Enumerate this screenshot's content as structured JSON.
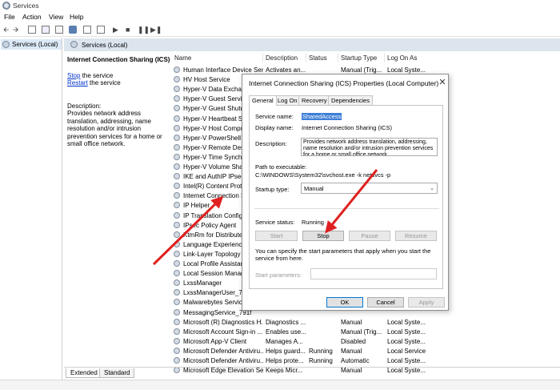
{
  "window": {
    "title": "Services"
  },
  "menu": [
    "File",
    "Action",
    "View",
    "Help"
  ],
  "left_pane": {
    "item": "Services (Local)"
  },
  "header": {
    "title": "Services (Local)"
  },
  "description_pane": {
    "service_name": "Internet Connection Sharing (ICS)",
    "stop_link": "Stop",
    "stop_suffix": " the service",
    "restart_link": "Restart",
    "restart_suffix": " the service",
    "description_label": "Description:",
    "description_text": "Provides network address translation, addressing, name resolution and/or intrusion prevention services for a home or small office network."
  },
  "columns": {
    "name": "Name",
    "description": "Description",
    "status": "Status",
    "startup_type": "Startup Type",
    "log_on_as": "Log On As"
  },
  "rows": [
    {
      "name": "Human Interface Device Ser...",
      "description": "Activates an...",
      "status": "",
      "startup": "Manual (Trig...",
      "logon": "Local Syste..."
    },
    {
      "name": "HV Host Service",
      "description": "",
      "status": "",
      "startup": "",
      "logon": ""
    },
    {
      "name": "Hyper-V Data Exchange",
      "description": "",
      "status": "",
      "startup": "",
      "logon": ""
    },
    {
      "name": "Hyper-V Guest Service",
      "description": "",
      "status": "",
      "startup": "",
      "logon": ""
    },
    {
      "name": "Hyper-V Guest Shutdo",
      "description": "",
      "status": "",
      "startup": "",
      "logon": ""
    },
    {
      "name": "Hyper-V Heartbeat Serv",
      "description": "",
      "status": "",
      "startup": "",
      "logon": ""
    },
    {
      "name": "Hyper-V Host Compute",
      "description": "",
      "status": "",
      "startup": "",
      "logon": ""
    },
    {
      "name": "Hyper-V PowerShell Di",
      "description": "",
      "status": "",
      "startup": "",
      "logon": ""
    },
    {
      "name": "Hyper-V Remote Deskt",
      "description": "",
      "status": "",
      "startup": "",
      "logon": ""
    },
    {
      "name": "Hyper-V Time Synchro",
      "description": "",
      "status": "",
      "startup": "",
      "logon": ""
    },
    {
      "name": "Hyper-V Volume Shade",
      "description": "",
      "status": "",
      "startup": "",
      "logon": ""
    },
    {
      "name": "IKE and AuthIP IPsec K",
      "description": "",
      "status": "",
      "startup": "",
      "logon": ""
    },
    {
      "name": "Intel(R) Content Protec",
      "description": "",
      "status": "",
      "startup": "",
      "logon": ""
    },
    {
      "name": "Internet Connection Sh",
      "description": "",
      "status": "",
      "startup": "",
      "logon": ""
    },
    {
      "name": "IP Helper",
      "description": "",
      "status": "",
      "startup": "",
      "logon": ""
    },
    {
      "name": "IP Translation Configu",
      "description": "",
      "status": "",
      "startup": "",
      "logon": ""
    },
    {
      "name": "IPsec Policy Agent",
      "description": "",
      "status": "",
      "startup": "",
      "logon": ""
    },
    {
      "name": "KtmRm for Distributed",
      "description": "",
      "status": "",
      "startup": "",
      "logon": ""
    },
    {
      "name": "Language Experience S",
      "description": "",
      "status": "",
      "startup": "",
      "logon": ""
    },
    {
      "name": "Link-Layer Topology Di",
      "description": "",
      "status": "",
      "startup": "",
      "logon": ""
    },
    {
      "name": "Local Profile Assistant S",
      "description": "",
      "status": "",
      "startup": "",
      "logon": ""
    },
    {
      "name": "Local Session Manager",
      "description": "",
      "status": "",
      "startup": "",
      "logon": ""
    },
    {
      "name": "LxssManager",
      "description": "",
      "status": "",
      "startup": "",
      "logon": ""
    },
    {
      "name": "LxssManagerUser_791f",
      "description": "",
      "status": "",
      "startup": "",
      "logon": ""
    },
    {
      "name": "Malwarebytes Service",
      "description": "",
      "status": "",
      "startup": "",
      "logon": ""
    },
    {
      "name": "MessagingService_791f",
      "description": "",
      "status": "",
      "startup": "",
      "logon": ""
    },
    {
      "name": "Microsoft (R) Diagnostics H...",
      "description": "Diagnostics ...",
      "status": "",
      "startup": "Manual",
      "logon": "Local Syste..."
    },
    {
      "name": "Microsoft Account Sign-in ...",
      "description": "Enables use...",
      "status": "",
      "startup": "Manual (Trig...",
      "logon": "Local Syste..."
    },
    {
      "name": "Microsoft App-V Client",
      "description": "Manages A...",
      "status": "",
      "startup": "Disabled",
      "logon": "Local Syste..."
    },
    {
      "name": "Microsoft Defender Antiviru...",
      "description": "Helps guard...",
      "status": "Running",
      "startup": "Manual",
      "logon": "Local Service"
    },
    {
      "name": "Microsoft Defender Antiviru...",
      "description": "Helps prote...",
      "status": "Running",
      "startup": "Automatic",
      "logon": "Local Syste..."
    },
    {
      "name": "Microsoft Edge Elevation Se...",
      "description": "Keeps Micr...",
      "status": "",
      "startup": "Manual",
      "logon": "Local Syste..."
    }
  ],
  "tabs": [
    "Extended",
    "Standard"
  ],
  "dialog": {
    "title": "Internet Connection Sharing (ICS) Properties (Local Computer)",
    "close": "✕",
    "tabs": [
      "General",
      "Log On",
      "Recovery",
      "Dependencies"
    ],
    "service_name_label": "Service name:",
    "service_name": "SharedAccess",
    "display_name_label": "Display name:",
    "display_name": "Internet Connection Sharing (ICS)",
    "description_label": "Description:",
    "description": "Provides network address translation, addressing, name resolution and/or intrusion prevention services for a home or small office network.",
    "path_label": "Path to executable:",
    "path": "C:\\WINDOWS\\System32\\svchost.exe -k netsvcs -p",
    "startup_label": "Startup type:",
    "startup_value": "Manual",
    "status_label": "Service status:",
    "status_value": "Running",
    "buttons": {
      "start": "Start",
      "stop": "Stop",
      "pause": "Pause",
      "resume": "Resume"
    },
    "hint": "You can specify the start parameters that apply when you start the service from here.",
    "params_label": "Start parameters:",
    "ok": "OK",
    "cancel": "Cancel",
    "apply": "Apply"
  },
  "colors": {
    "arrow": "#e02020",
    "selection": "#3d7fd6",
    "header_bg": "#dce4ee"
  }
}
